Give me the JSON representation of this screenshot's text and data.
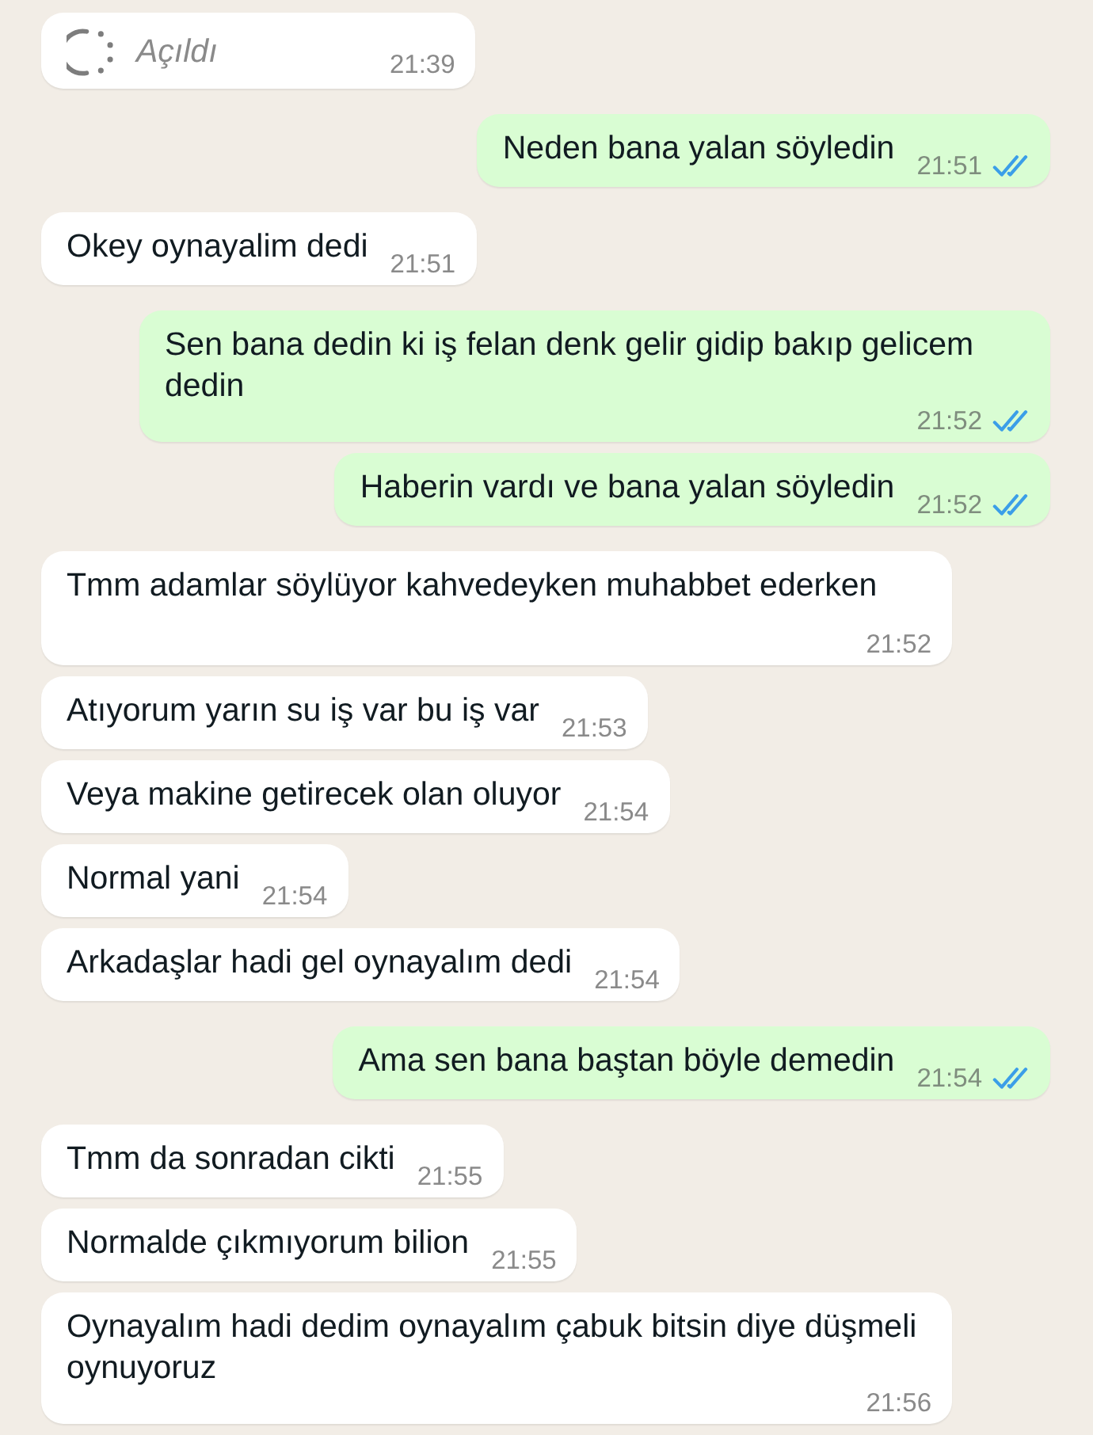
{
  "messages": [
    {
      "outgoing": false,
      "kind": "view_once",
      "text": "Açıldı",
      "time": "21:39"
    },
    {
      "outgoing": true,
      "kind": "text",
      "text": "Neden bana yalan söyledin",
      "time": "21:51",
      "read": true
    },
    {
      "outgoing": false,
      "kind": "text",
      "text": "Okey oynayalim dedi",
      "time": "21:51"
    },
    {
      "outgoing": true,
      "kind": "text",
      "text": "Sen bana dedin ki iş felan denk gelir gidip bakıp gelicem dedin",
      "time": "21:52",
      "read": true
    },
    {
      "outgoing": true,
      "kind": "text",
      "text": "Haberin vardı ve bana yalan söyledin",
      "time": "21:52",
      "read": true
    },
    {
      "outgoing": false,
      "kind": "text",
      "text": "Tmm adamlar söylüyor kahvedeyken muhabbet ederken",
      "time": "21:52"
    },
    {
      "outgoing": false,
      "kind": "text",
      "text": "Atıyorum yarın su iş var bu iş var",
      "time": "21:53"
    },
    {
      "outgoing": false,
      "kind": "text",
      "text": "Veya makine getirecek olan oluyor",
      "time": "21:54"
    },
    {
      "outgoing": false,
      "kind": "text",
      "text": "Normal yani",
      "time": "21:54"
    },
    {
      "outgoing": false,
      "kind": "text",
      "text": "Arkadaşlar hadi gel oynayalım dedi",
      "time": "21:54"
    },
    {
      "outgoing": true,
      "kind": "text",
      "text": "Ama sen bana baştan böyle demedin",
      "time": "21:54",
      "read": true
    },
    {
      "outgoing": false,
      "kind": "text",
      "text": "Tmm da sonradan cikti",
      "time": "21:55"
    },
    {
      "outgoing": false,
      "kind": "text",
      "text": "Normalde çıkmıyorum bilion",
      "time": "21:55"
    },
    {
      "outgoing": false,
      "kind": "text",
      "text": "Oynayalım hadi dedim oynayalım çabuk bitsin diye düşmeli oynuyoruz",
      "time": "21:56"
    }
  ]
}
